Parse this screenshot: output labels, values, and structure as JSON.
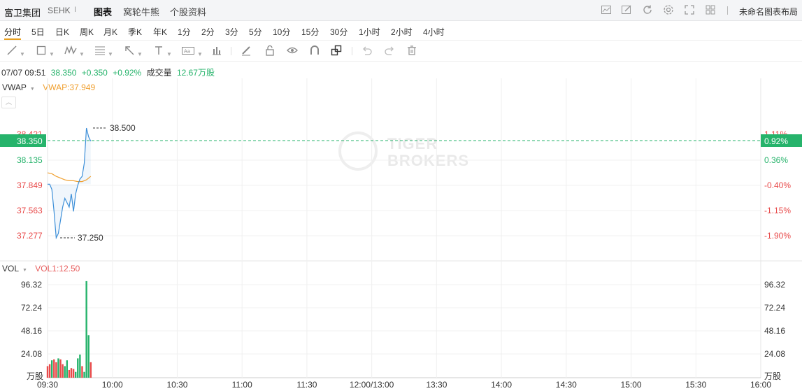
{
  "header": {
    "stock_name": "富卫集团",
    "exchange": "SEHK",
    "separator": "I",
    "tabs": [
      {
        "label": "图表",
        "active": true
      },
      {
        "label": "窝轮牛熊",
        "active": false
      },
      {
        "label": "个股资料",
        "active": false
      }
    ],
    "layout_label": "未命名图表布局",
    "right_icons": [
      "chart-style-icon",
      "draw-icon",
      "refresh-icon",
      "settings-icon",
      "fullscreen-icon",
      "grid-layout-icon"
    ]
  },
  "periods": [
    "分时",
    "5日",
    "日K",
    "周K",
    "月K",
    "季K",
    "年K",
    "1分",
    "2分",
    "3分",
    "5分",
    "10分",
    "15分",
    "30分",
    "1小时",
    "2小时",
    "4小时"
  ],
  "toolbar": [
    "line-tool-icon",
    "rect-tool-icon",
    "pattern-tool-icon",
    "fib-tool-icon",
    "arrow-tool-icon",
    "text-tool-icon",
    "label-tool-icon",
    "measure-icon",
    "pen-icon",
    "lock-icon",
    "eye-icon",
    "magnet-icon",
    "layers-icon",
    "undo-icon",
    "redo-icon",
    "trash-icon"
  ],
  "quote": {
    "datetime": "07/07 09:51",
    "price": "38.350",
    "change": "+0.350",
    "change_pct": "+0.92%",
    "volume_label": "成交量",
    "volume": "12.67万股"
  },
  "price_panel": {
    "indicator": "VWAP",
    "vwap_label": "VWAP:37.949",
    "current_price_tag": "38.350",
    "current_pct_tag": "0.92%",
    "hidden_top_left": "38.421",
    "hidden_top_right": "1.11%",
    "left_ticks": [
      "38.135",
      "37.849",
      "37.563",
      "37.277"
    ],
    "right_ticks": [
      "0.36%",
      "-0.40%",
      "-1.15%",
      "-1.90%"
    ],
    "high_label": "38.500",
    "low_label": "37.250"
  },
  "volume_panel": {
    "indicator": "VOL",
    "vol_label": "VOL1:12.50",
    "ticks": [
      "96.32",
      "72.24",
      "48.16",
      "24.08"
    ],
    "unit": "万股"
  },
  "x_axis": [
    "09:30",
    "10:00",
    "10:30",
    "11:00",
    "11:30",
    "12:00/13:00",
    "13:30",
    "14:00",
    "14:30",
    "15:00",
    "15:30",
    "16:00"
  ],
  "watermark": {
    "line1": "TIGER",
    "line2": "BROKERS"
  },
  "colors": {
    "up": "#26b36b",
    "down": "#e84a4a",
    "line": "#3d8fd8",
    "vwap": "#f0a030",
    "accent": "#e8a020"
  },
  "chart_data": {
    "type": "line",
    "price_series": [
      [
        0,
        37.86
      ],
      [
        1,
        37.86
      ],
      [
        2,
        37.8
      ],
      [
        3,
        37.55
      ],
      [
        4,
        37.25
      ],
      [
        5,
        37.3
      ],
      [
        6,
        37.45
      ],
      [
        7,
        37.6
      ],
      [
        8,
        37.7
      ],
      [
        9,
        37.65
      ],
      [
        10,
        37.6
      ],
      [
        11,
        37.75
      ],
      [
        12,
        37.55
      ],
      [
        13,
        37.75
      ],
      [
        14,
        37.85
      ],
      [
        15,
        37.92
      ],
      [
        16,
        37.95
      ],
      [
        17,
        38.1
      ],
      [
        18,
        38.5
      ],
      [
        19,
        38.4
      ],
      [
        20,
        38.35
      ]
    ],
    "vwap_series": [
      [
        0,
        37.99
      ],
      [
        2,
        37.98
      ],
      [
        4,
        37.95
      ],
      [
        6,
        37.93
      ],
      [
        8,
        37.91
      ],
      [
        10,
        37.9
      ],
      [
        12,
        37.9
      ],
      [
        14,
        37.89
      ],
      [
        16,
        37.89
      ],
      [
        18,
        37.91
      ],
      [
        20,
        37.95
      ]
    ],
    "volume_bars": [
      [
        0,
        12,
        "down"
      ],
      [
        1,
        14,
        "down"
      ],
      [
        2,
        18,
        "up"
      ],
      [
        3,
        19,
        "down"
      ],
      [
        4,
        16,
        "down"
      ],
      [
        5,
        20,
        "up"
      ],
      [
        6,
        19,
        "down"
      ],
      [
        7,
        14,
        "down"
      ],
      [
        8,
        12,
        "up"
      ],
      [
        9,
        18,
        "up"
      ],
      [
        10,
        8,
        "down"
      ],
      [
        11,
        10,
        "down"
      ],
      [
        12,
        9,
        "down"
      ],
      [
        13,
        6,
        "up"
      ],
      [
        14,
        20,
        "up"
      ],
      [
        15,
        24,
        "up"
      ],
      [
        16,
        12,
        "down"
      ],
      [
        17,
        6,
        "up"
      ],
      [
        18,
        100,
        "up"
      ],
      [
        19,
        44,
        "up"
      ],
      [
        20,
        16,
        "down"
      ]
    ]
  }
}
